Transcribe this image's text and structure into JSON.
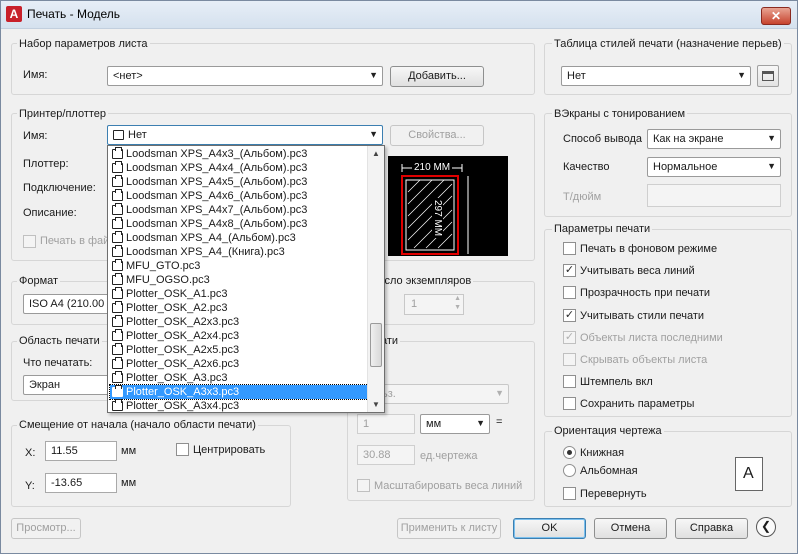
{
  "window": {
    "title": "Печать - Модель",
    "close_label": "✕"
  },
  "page_setup": {
    "group_title": "Набор параметров листа",
    "name_label": "Имя:",
    "name_value": "<нет>",
    "add_button": "Добавить..."
  },
  "printer": {
    "group_title": "Принтер/плоттер",
    "name_label": "Имя:",
    "name_value": "Нет",
    "properties_button": "Свойства...",
    "plotter_label": "Плоттер:",
    "connection_label": "Подключение:",
    "description_label": "Описание:",
    "print_to_file_label": "Печать в фай",
    "paper_width_label": "210 ММ",
    "paper_height_label": "297 ММ",
    "dropdown_items": [
      "Loodsman XPS_A4x3_(Альбом).pc3",
      "Loodsman XPS_A4x4_(Альбом).pc3",
      "Loodsman XPS_A4x5_(Альбом).pc3",
      "Loodsman XPS_A4x6_(Альбом).pc3",
      "Loodsman XPS_A4x7_(Альбом).pc3",
      "Loodsman XPS_A4x8_(Альбом).pc3",
      "Loodsman XPS_A4_(Альбом).pc3",
      "Loodsman XPS_A4_(Книга).pc3",
      "MFU_GTO.pc3",
      "MFU_OGSO.pc3",
      "Plotter_OSK_A1.pc3",
      "Plotter_OSK_A2.pc3",
      "Plotter_OSK_A2x3.pc3",
      "Plotter_OSK_A2x4.pc3",
      "Plotter_OSK_A2x5.pc3",
      "Plotter_OSK_A2x6.pc3",
      "Plotter_OSK_A3.pc3",
      "Plotter_OSK_A3x3.pc3",
      "Plotter_OSK_A3x4.pc3"
    ],
    "selected_item": "Plotter_OSK_A3x3.pc3"
  },
  "format": {
    "group_title": "Формат",
    "value": "ISO A4 (210.00"
  },
  "copies": {
    "label": "Число экземпляров",
    "value": "1"
  },
  "print_area": {
    "group_title": "Область печати",
    "what_label": "Что печатать:",
    "what_value": "Экран"
  },
  "scale": {
    "group_title": "ати",
    "combo_value": "ьз.",
    "value1": "1",
    "unit": "мм",
    "equals": "=",
    "value2": "30.88",
    "unit2_label": "ед.чертежа",
    "scale_lineweights": "Масштабировать веса линий"
  },
  "offset": {
    "group_title": "Смещение от начала (начало области печати)",
    "x_label": "X:",
    "x_value": "11.55",
    "x_unit": "мм",
    "y_label": "Y:",
    "y_value": "-13.65",
    "y_unit": "мм",
    "center_label": "Центрировать"
  },
  "plot_style": {
    "group_title": "Таблица стилей печати (назначение перьев)",
    "value": "Нет"
  },
  "shaded": {
    "group_title": "ВЭкраны с тонированием",
    "output_label": "Способ вывода",
    "output_value": "Как на экране",
    "quality_label": "Качество",
    "quality_value": "Нормальное",
    "dpi_label": "Т/дюйм"
  },
  "plot_options": {
    "group_title": "Параметры печати",
    "items": [
      {
        "label": "Печать в фоновом режиме",
        "checked": false,
        "disabled": false
      },
      {
        "label": "Учитывать веса линий",
        "checked": true,
        "disabled": false
      },
      {
        "label": "Прозрачность при печати",
        "checked": false,
        "disabled": false
      },
      {
        "label": "Учитывать стили печати",
        "checked": true,
        "disabled": false
      },
      {
        "label": "Объекты листа последними",
        "checked": true,
        "disabled": true
      },
      {
        "label": "Скрывать объекты листа",
        "checked": false,
        "disabled": true
      },
      {
        "label": "Штемпель вкл",
        "checked": false,
        "disabled": false
      },
      {
        "label": "Сохранить параметры",
        "checked": false,
        "disabled": false
      }
    ]
  },
  "orientation": {
    "group_title": "Ориентация чертежа",
    "portrait": "Книжная",
    "landscape": "Альбомная",
    "upside_down": "Перевернуть",
    "preview_letter": "A"
  },
  "footer": {
    "preview_button": "Просмотр...",
    "apply_button": "Применить к листу",
    "ok_button": "OK",
    "cancel_button": "Отмена",
    "help_button": "Справка"
  },
  "colors": {
    "selection": "#3399ff",
    "preview_bg": "#000000",
    "preview_paper_border": "#e00000"
  }
}
